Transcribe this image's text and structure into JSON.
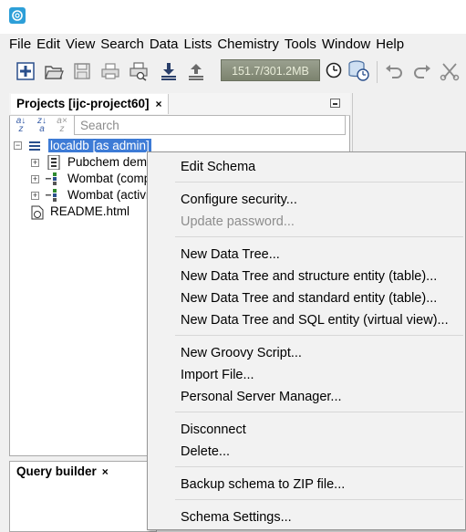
{
  "menubar": [
    "File",
    "Edit",
    "View",
    "Search",
    "Data",
    "Lists",
    "Chemistry",
    "Tools",
    "Window",
    "Help"
  ],
  "toolbar": {
    "memory": "151.7/301.2MB",
    "icons": [
      "new-icon",
      "open-folder-icon",
      "save-icon",
      "print-icon",
      "print-preview-icon",
      "import-icon",
      "export-icon",
      "gc-icon",
      "schema-icon",
      "undo-icon",
      "redo-icon",
      "cut-icon"
    ]
  },
  "projects": {
    "tab_label": "Projects [ijc-project60]",
    "close": "×",
    "search_placeholder": "Search",
    "tree": {
      "root": "localdb [as admin]",
      "children": [
        "Pubchem demo",
        "Wombat (comp",
        "Wombat (activit",
        "README.html"
      ]
    }
  },
  "query_builder": {
    "tab_label": "Query builder",
    "close": "×"
  },
  "context_menu": {
    "items": [
      {
        "label": "Edit Schema",
        "enabled": true
      },
      {
        "label": "Configure security...",
        "enabled": true
      },
      {
        "label": "Update password...",
        "enabled": false
      },
      {
        "label": "New Data Tree...",
        "enabled": true
      },
      {
        "label": "New Data Tree and structure entity (table)...",
        "enabled": true
      },
      {
        "label": "New Data Tree and standard entity (table)...",
        "enabled": true
      },
      {
        "label": "New Data Tree and SQL entity (virtual view)...",
        "enabled": true
      },
      {
        "label": "New Groovy Script...",
        "enabled": true
      },
      {
        "label": "Import File...",
        "enabled": true
      },
      {
        "label": "Personal Server Manager...",
        "enabled": true
      },
      {
        "label": "Disconnect",
        "enabled": true
      },
      {
        "label": "Delete...",
        "enabled": true
      },
      {
        "label": "Backup schema to ZIP file...",
        "enabled": true
      },
      {
        "label": "Schema Settings...",
        "enabled": true
      }
    ]
  },
  "colors": {
    "selection": "#3d7bd6",
    "memory_bg": "#8a907d"
  }
}
